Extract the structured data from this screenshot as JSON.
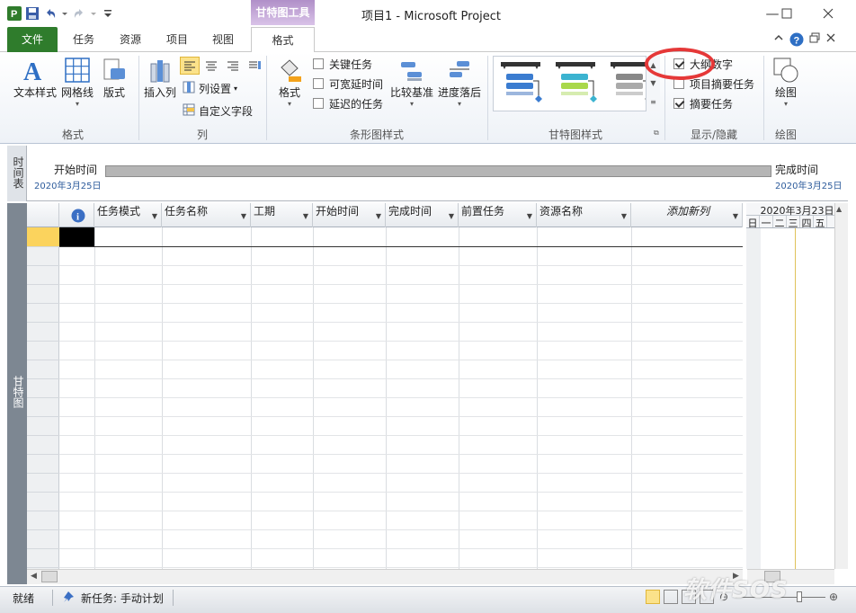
{
  "window": {
    "title": "项目1 - Microsoft Project",
    "context_tab_header": "甘特图工具"
  },
  "tabs": [
    {
      "label": "文件"
    },
    {
      "label": "任务"
    },
    {
      "label": "资源"
    },
    {
      "label": "项目"
    },
    {
      "label": "视图"
    },
    {
      "label": "格式"
    }
  ],
  "ribbon": {
    "groups": {
      "format": {
        "label": "格式",
        "buttons": [
          "文本样式",
          "网格线",
          "版式"
        ]
      },
      "columns": {
        "label": "列",
        "insert_column": "插入列",
        "column_settings": "列设置",
        "custom_fields": "自定义字段"
      },
      "bar_styles": {
        "label": "条形图样式",
        "format_button": "格式",
        "critical_tasks": "关键任务",
        "slack": "可宽延时间",
        "late_tasks": "延迟的任务",
        "baseline": "比较基准",
        "slippage": "进度落后"
      },
      "gantt_styles": {
        "label": "甘特图样式"
      },
      "show_hide": {
        "label": "显示/隐藏",
        "outline_number": "大纲数字",
        "project_summary": "项目摘要任务",
        "summary_tasks": "摘要任务"
      },
      "drawings": {
        "label": "绘图",
        "drawing": "绘图"
      }
    },
    "checkbox_state": {
      "critical_tasks": false,
      "slack": false,
      "late_tasks": false,
      "outline_number": true,
      "project_summary": false,
      "summary_tasks": true
    }
  },
  "timeline": {
    "side_label": "时间表",
    "start_label": "开始时间",
    "start_date": "2020年3月25日",
    "finish_label": "完成时间",
    "finish_date": "2020年3月25日"
  },
  "gantt": {
    "side_label": "甘特图",
    "columns": [
      "任务模式",
      "任务名称",
      "工期",
      "开始时间",
      "完成时间",
      "前置任务",
      "资源名称",
      "添加新列"
    ],
    "week_header": "2020年3月23日",
    "day_headers": [
      "日",
      "一",
      "二",
      "三",
      "四",
      "五"
    ]
  },
  "status_bar": {
    "ready": "就绪",
    "new_tasks": "新任务: 手动计划"
  },
  "watermark": "软件SOS",
  "colors": {
    "file_tab": "#2f7c2c",
    "context_tab": "#b08fc8",
    "selected_row": "#fbd35d",
    "annotation_circle": "#e53838"
  }
}
